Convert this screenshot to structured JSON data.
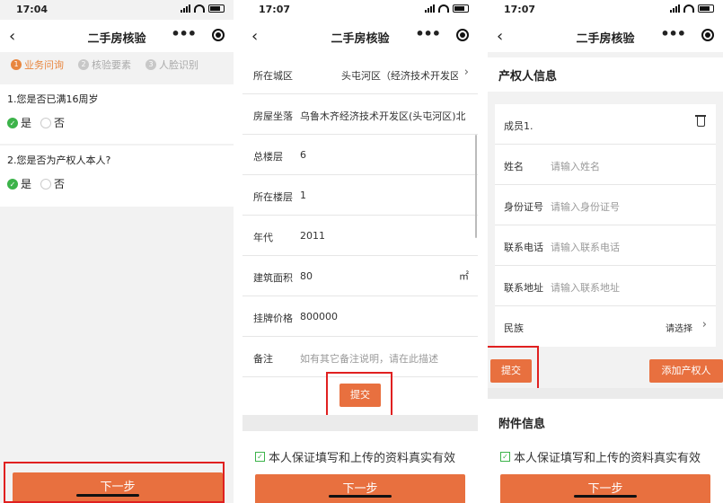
{
  "phone1": {
    "status_time": "17:04",
    "nav_title": "二手房核验",
    "back_icon": "‹",
    "steps": [
      {
        "num": "1",
        "label": "业务问询"
      },
      {
        "num": "2",
        "label": "核验要素"
      },
      {
        "num": "3",
        "label": "人脸识别"
      }
    ],
    "questions": [
      {
        "text": "1.您是否已满16周岁",
        "yes": "是",
        "no": "否",
        "selected": "是"
      },
      {
        "text": "2.您是否为产权人本人?",
        "yes": "是",
        "no": "否",
        "selected": "是"
      }
    ],
    "next_button": "下一步"
  },
  "phone2": {
    "status_time": "17:07",
    "nav_title": "二手房核验",
    "fields": [
      {
        "label": "所在城区",
        "value": "头屯河区（经济技术开发区）"
      },
      {
        "label": "房屋坐落",
        "value": "乌鲁木齐经济技术开发区(头屯河区)北京"
      },
      {
        "label": "总楼层",
        "value": "6"
      },
      {
        "label": "所在楼层",
        "value": "1"
      },
      {
        "label": "年代",
        "value": "2011"
      },
      {
        "label": "建筑面积",
        "value": "80",
        "unit": "㎡"
      },
      {
        "label": "挂牌价格",
        "value": "800000"
      },
      {
        "label": "备注",
        "placeholder": "如有其它备注说明，请在此描述"
      }
    ],
    "submit_button": "提交",
    "promise_text": "本人保证填写和上传的资料真实有效",
    "next_button": "下一步"
  },
  "phone3": {
    "status_time": "17:07",
    "nav_title": "二手房核验",
    "owner_section_title": "产权人信息",
    "member_label": "成员1.",
    "fields": [
      {
        "label": "姓名",
        "placeholder": "请输入姓名"
      },
      {
        "label": "身份证号",
        "placeholder": "请输入身份证号"
      },
      {
        "label": "联系电话",
        "placeholder": "请输入联系电话"
      },
      {
        "label": "联系地址",
        "placeholder": "请输入联系地址"
      }
    ],
    "ethnicity_label": "民族",
    "ethnicity_select": "请选择",
    "submit_button": "提交",
    "add_owner_button": "添加产权人",
    "attachment_section_title": "附件信息",
    "promise_text": "本人保证填写和上传的资料真实有效",
    "next_button": "下一步"
  },
  "colors": {
    "accent": "#e8703f",
    "step_active": "#e8863f",
    "check_green": "#3cb34a",
    "highlight_red": "#e02020"
  }
}
